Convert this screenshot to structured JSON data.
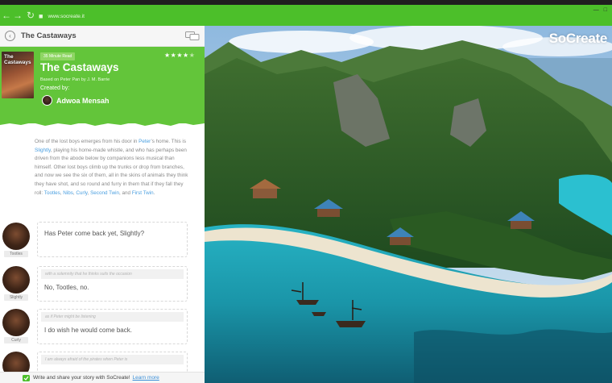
{
  "browser": {
    "url": "www.socreate.it",
    "back": "←",
    "forward": "→",
    "reload": "↻"
  },
  "topbar": {
    "title": "The Castaways"
  },
  "story": {
    "badge": "35 Minute Read",
    "title": "The Castaways",
    "subtitle": "Based on Peter Pan by J. M. Barrie",
    "created_by": "Created by:",
    "author": "Adwoa Mensah",
    "cover_title": "The\nCastaways",
    "rating_filled": "★★★★",
    "rating_empty": "★"
  },
  "narration": {
    "parts": [
      "One of the lost boys emerges from his door in ",
      "Peter",
      "’s home. This is ",
      "Slightly",
      ", playing his home-made whistle, and who has perhaps been driven from the abode below by companions less musical than himself. Other lost boys climb up the trunks or drop from branches, and now we see the six of them, all in the skins of animals they think they have shot, and so round and furry in them that if they fall they roll: ",
      "Tootles",
      ", ",
      "Nibs",
      ", ",
      "Curly",
      ", ",
      "Second Twin",
      ", and ",
      "First Twin",
      "."
    ]
  },
  "lines": [
    {
      "speaker": "Tootles",
      "direction": "",
      "text": "Has Peter come back yet, Slightly?"
    },
    {
      "speaker": "Slightly",
      "direction": "with a solemnity that he thinks suits the occasion",
      "text": "No, Tootles, no."
    },
    {
      "speaker": "Curly",
      "direction": "as if Peter might be listening",
      "text": "I do wish he would come back."
    },
    {
      "speaker": "",
      "direction": "I am always afraid of the pirates when Peter is",
      "text": ""
    }
  ],
  "footer": {
    "text": "Write and share your story with SoCreate!",
    "link": "Learn more"
  },
  "brand": "SoCreate",
  "colors": {
    "accent": "#63c53a",
    "link": "#4a9fe0"
  }
}
